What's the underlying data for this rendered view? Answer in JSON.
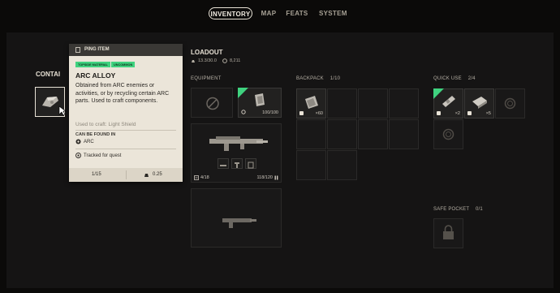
{
  "nav": {
    "tabs": [
      {
        "label": "INVENTORY",
        "active": true
      },
      {
        "label": "MAP",
        "active": false
      },
      {
        "label": "FEATS",
        "active": false
      },
      {
        "label": "SYSTEM",
        "active": false
      }
    ]
  },
  "containers": {
    "title": "CONTAI"
  },
  "loadout": {
    "title": "LOADOUT",
    "weight": "13.3/30.0",
    "value": "8,211"
  },
  "equipment": {
    "label": "EQUIPMENT",
    "shield": {
      "label": "100/100"
    },
    "weapon1": {
      "ammo_type_count": "4/18",
      "ammo": "118/120"
    }
  },
  "backpack": {
    "label": "BACKPACK",
    "count": "1/10",
    "item_qty": "×60"
  },
  "quick_use": {
    "label": "QUICK USE",
    "count": "2/4",
    "slot1_qty": "×2",
    "slot2_qty": "×5"
  },
  "safe_pocket": {
    "label": "SAFE POCKET",
    "count": "0/1"
  },
  "tooltip": {
    "header": "PING ITEM",
    "tags": [
      "TOPSIDE MATERIAL",
      "UNCOMMON"
    ],
    "title": "ARC ALLOY",
    "description": "Obtained from ARC enemies or activities, or by recycling certain ARC parts. Used to craft components.",
    "used_to_craft": "Used to craft: Light Shield",
    "found_in_label": "CAN BE FOUND IN",
    "found_in_value": "ARC",
    "quest_note": "Tracked for quest",
    "stack": "1/15",
    "weight": "0.25"
  },
  "colors": {
    "accent_green": "#3fd27f",
    "tooltip_bg": "#ebe5d9",
    "panel_bg": "#151414"
  },
  "icons": [
    "weight-icon",
    "coin-icon",
    "prohibited-icon",
    "shield-icon",
    "ping-icon",
    "arc-icon",
    "quest-icon",
    "lock-icon"
  ]
}
